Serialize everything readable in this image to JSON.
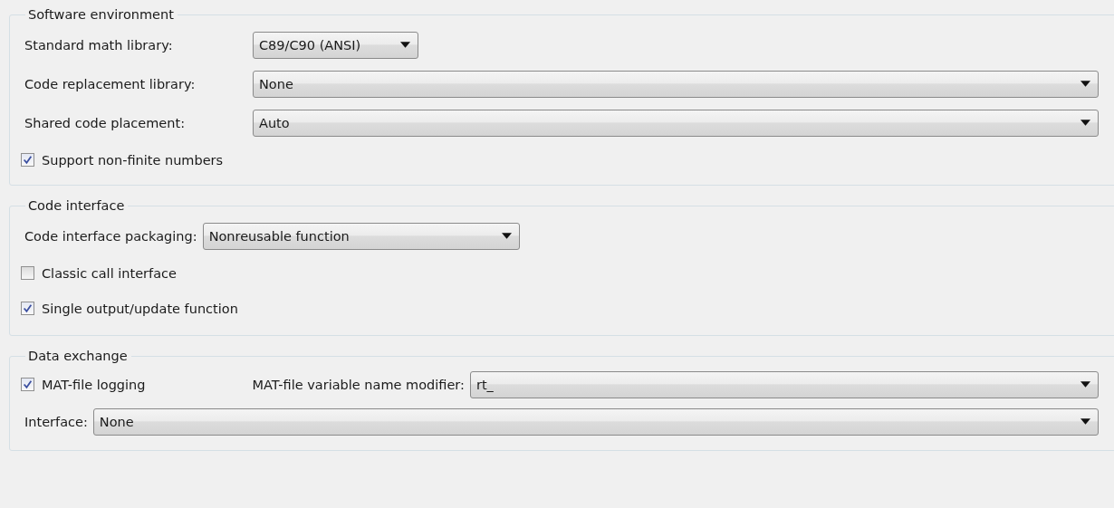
{
  "sections": [
    {
      "title": "Software environment",
      "rows": [
        {
          "kind": "short_dropdown",
          "label": "Standard math library:",
          "value": "C89/C90 (ANSI)"
        },
        {
          "kind": "dropdown",
          "label": "Code replacement library:",
          "value": "None"
        },
        {
          "kind": "dropdown",
          "label": "Shared code placement:",
          "value": "Auto"
        },
        {
          "kind": "checkbox",
          "label": "Support non-finite numbers",
          "checked": true
        }
      ]
    },
    {
      "title": "Code interface",
      "rows": [
        {
          "kind": "medium_dropdown",
          "label": "Code interface packaging:",
          "value": "Nonreusable function"
        },
        {
          "kind": "checkbox",
          "label": "Classic call interface",
          "checked": false
        },
        {
          "kind": "checkbox",
          "label": "Single output/update function",
          "checked": true
        }
      ]
    },
    {
      "title": "Data exchange",
      "rows": [
        {
          "kind": "checkbox_dropdown",
          "label": "MAT-file logging",
          "checked": true,
          "field_label": "MAT-file variable name modifier:",
          "value": "rt_"
        },
        {
          "kind": "dropdown",
          "label": "Interface:",
          "value": "None"
        }
      ]
    }
  ]
}
